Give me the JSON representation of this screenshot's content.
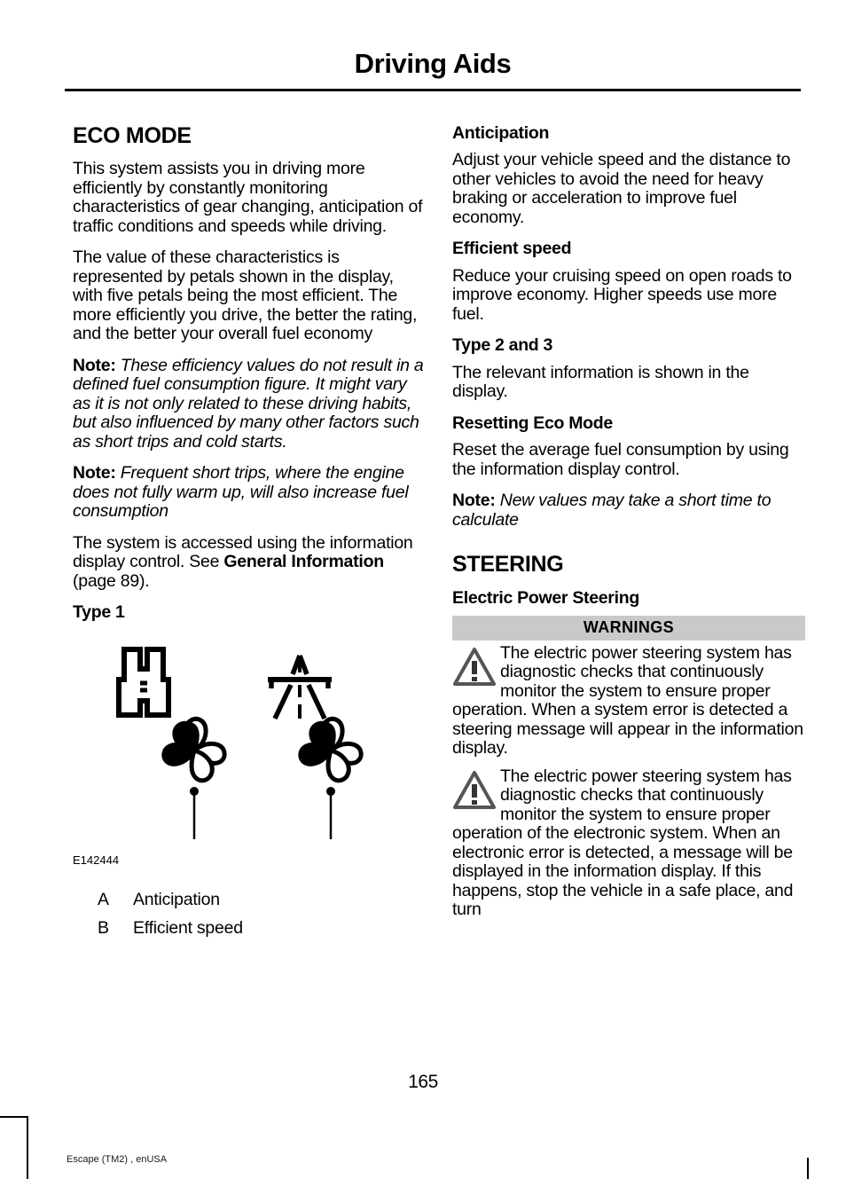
{
  "header": {
    "title": "Driving Aids"
  },
  "left_column": {
    "eco_mode_heading": "ECO MODE",
    "paragraph_1": "This system assists you in driving more efficiently by constantly monitoring characteristics of gear changing, anticipation of traffic conditions and speeds while driving.",
    "paragraph_2": "The value of these characteristics is represented by petals shown in the display, with five petals being the most efficient. The more efficiently you drive, the better the rating, and the better your overall fuel economy",
    "note_1_label": "Note:",
    "note_1_text": " These efficiency values do not result in a defined fuel consumption figure. It might vary as it is not only related to these driving habits, but also influenced by many other factors such as short trips and cold starts.",
    "note_2_label": "Note:",
    "note_2_text": " Frequent short trips, where the engine does not fully warm up, will also increase fuel consumption",
    "paragraph_3_part1": "The system is accessed using the information display control.  See ",
    "paragraph_3_bold": "General Information",
    "paragraph_3_part2": " (page 89).",
    "type_1_heading": "Type 1",
    "figure_id": "E142444",
    "legend": [
      {
        "key": "A",
        "label": "Anticipation"
      },
      {
        "key": "B",
        "label": "Efficient speed"
      }
    ]
  },
  "right_column": {
    "anticipation_heading": "Anticipation",
    "anticipation_text": "Adjust your vehicle speed and the distance to other vehicles to avoid the need for heavy braking or acceleration to improve fuel economy.",
    "efficient_speed_heading": "Efficient speed",
    "efficient_speed_text": "Reduce your cruising speed on open roads to improve economy. Higher speeds use more fuel.",
    "type_2_3_heading": "Type 2 and 3",
    "type_2_3_text": "The relevant information is shown in the display.",
    "resetting_heading": "Resetting Eco Mode",
    "resetting_text": "Reset the average fuel consumption by using the information display control.",
    "note_label": "Note:",
    "note_text": " New values may take a short time to calculate",
    "steering_heading": "STEERING",
    "eps_heading": "Electric Power Steering",
    "warnings_title": "WARNINGS",
    "warnings": [
      "The electric power steering system has diagnostic checks that continuously monitor the system to ensure proper operation. When a system error is detected a steering message will appear in the information display.",
      "The electric power steering system has diagnostic checks that continuously monitor the system to ensure proper operation of the electronic system. When an electronic error is detected, a message will be displayed in the information display. If this happens, stop the vehicle in a safe place, and turn"
    ]
  },
  "footer": {
    "page_number": "165",
    "imprint": "Escape (TM2) , enUSA"
  },
  "colors": {
    "warning_bar_bg": "#c9c9c9",
    "text": "#000000",
    "warning_icon": "#5a5a5a"
  }
}
